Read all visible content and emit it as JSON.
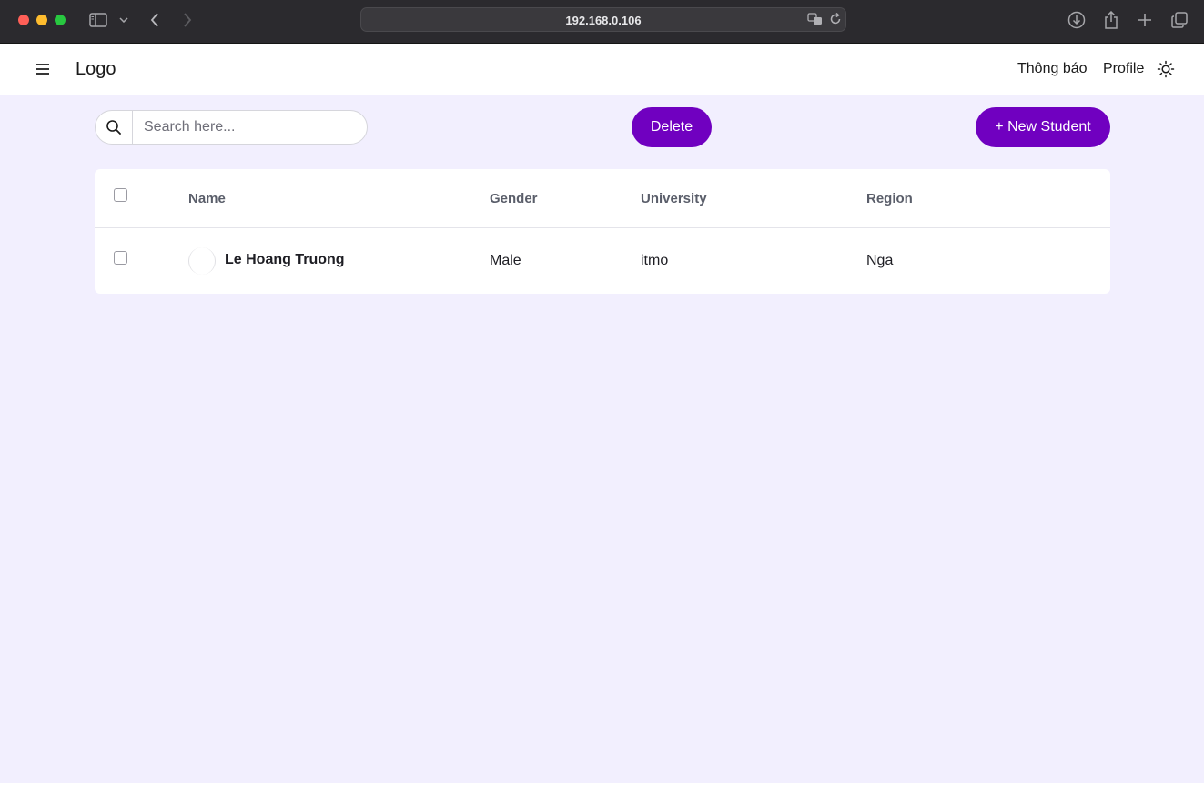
{
  "browser": {
    "url": "192.168.0.106"
  },
  "header": {
    "logo": "Logo",
    "nav": {
      "notifications": "Thông báo",
      "profile": "Profile"
    }
  },
  "toolbar": {
    "search_placeholder": "Search here...",
    "delete_label": "Delete",
    "new_label": "+ New Student"
  },
  "table": {
    "columns": [
      "Name",
      "Gender",
      "University",
      "Region"
    ],
    "rows": [
      {
        "name": "Le Hoang Truong",
        "gender": "Male",
        "university": "itmo",
        "region": "Nga"
      }
    ]
  },
  "colors": {
    "accent": "#7000c0",
    "content_bg": "#f2effe",
    "chrome_bg": "#2b2a2e"
  },
  "icons": {
    "menu": "hamburger-icon",
    "theme": "sun-icon",
    "search": "search-icon"
  }
}
